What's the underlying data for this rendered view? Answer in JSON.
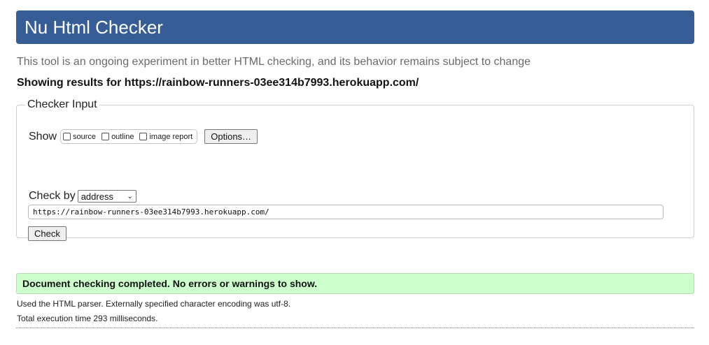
{
  "header": {
    "title": "Nu Html Checker"
  },
  "intro": "This tool is an ongoing experiment in better HTML checking, and its behavior remains subject to change",
  "results_for": "Showing results for https://rainbow-runners-03ee314b7993.herokuapp.com/",
  "checker_input": {
    "legend": "Checker Input",
    "show_label": "Show",
    "show_options": [
      {
        "label": "source",
        "checked": false
      },
      {
        "label": "outline",
        "checked": false
      },
      {
        "label": "image report",
        "checked": false
      }
    ],
    "options_button": "Options…",
    "check_by_label": "Check by",
    "check_by_value": "address",
    "url_value": "https://rainbow-runners-03ee314b7993.herokuapp.com/",
    "check_button": "Check"
  },
  "result": {
    "message": "Document checking completed. No errors or warnings to show.",
    "parser_info": "Used the HTML parser. Externally specified character encoding was utf-8.",
    "execution_time": "Total execution time 293 milliseconds."
  },
  "colors": {
    "header_bg": "#365d95",
    "success_bg": "#ccffcc"
  }
}
